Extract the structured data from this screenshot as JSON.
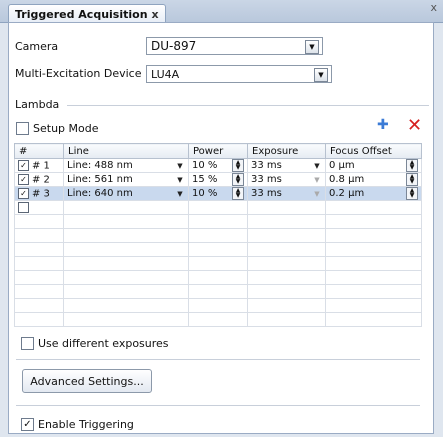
{
  "tab": {
    "title": "Triggered Acquisition",
    "close": "x"
  },
  "window": {
    "close": "x"
  },
  "camera": {
    "label": "Camera",
    "value": "DU-897"
  },
  "device": {
    "label": "Multi-Excitation Device",
    "value": "LU4A"
  },
  "lambda": {
    "label": "Lambda"
  },
  "setup_mode": {
    "label": "Setup Mode",
    "checked": false
  },
  "table": {
    "headers": [
      "#",
      "Line",
      "Power",
      "Exposure",
      "Focus Offset"
    ],
    "rows": [
      {
        "num": "# 1",
        "line": "Line: 488 nm",
        "power": "10 %",
        "exposure": "33 ms",
        "focus": "0 µm",
        "checked": true
      },
      {
        "num": "# 2",
        "line": "Line: 561 nm",
        "power": "15 %",
        "exposure": "33 ms",
        "focus": "0.8 µm",
        "checked": true
      },
      {
        "num": "# 3",
        "line": "Line: 640 nm",
        "power": "10 %",
        "exposure": "33 ms",
        "focus": "0.2 µm",
        "checked": true
      }
    ]
  },
  "use_diff_exposures": {
    "label": "Use different exposures",
    "checked": false
  },
  "advanced_button": {
    "label": "Advanced Settings..."
  },
  "enable_triggering": {
    "label": "Enable Triggering",
    "checked": true
  },
  "icons": {
    "add": "plus-icon",
    "delete": "delete-icon"
  },
  "colors": {
    "add": "#3b7bd6",
    "delete": "#d62020",
    "selected_row": "#c9d9ee"
  }
}
